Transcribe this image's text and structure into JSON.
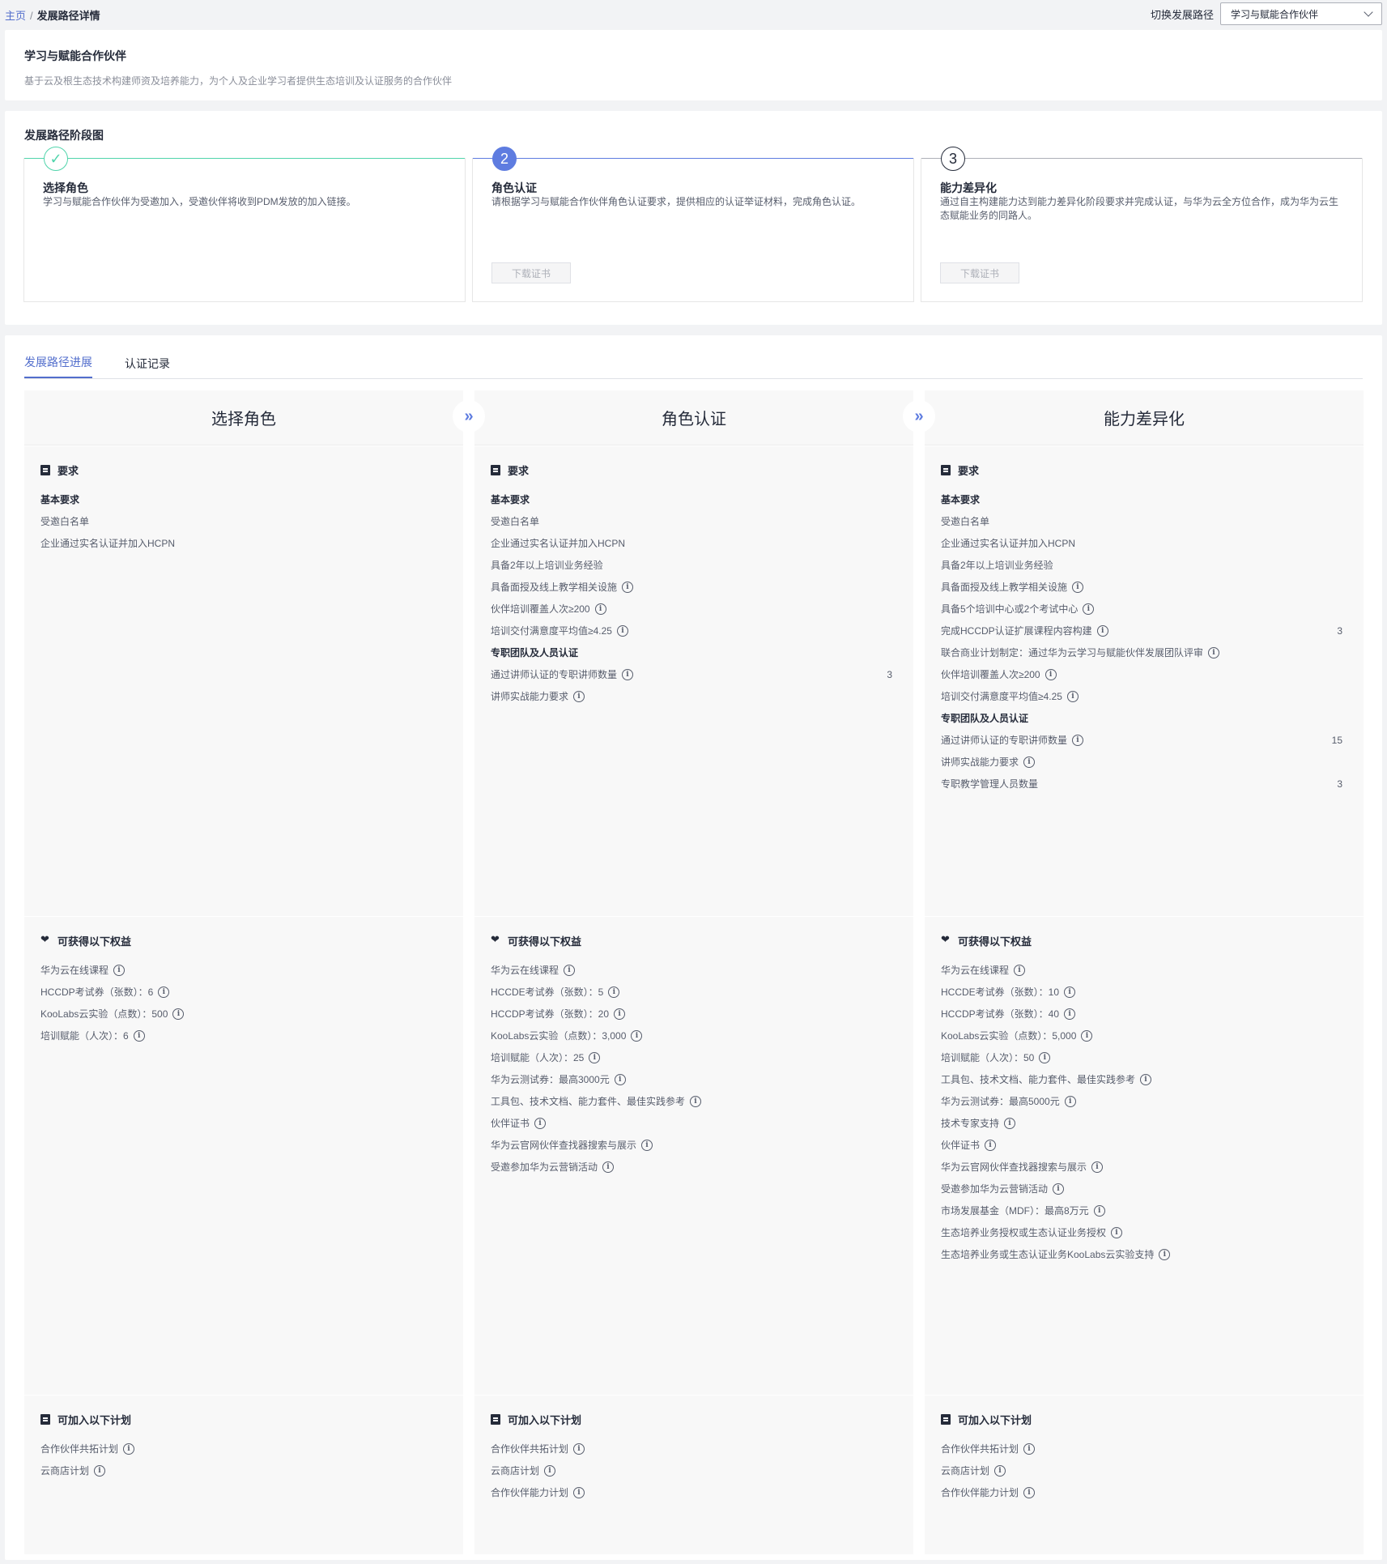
{
  "breadcrumb": {
    "home": "主页",
    "sep": "/",
    "current": "发展路径详情"
  },
  "switcher": {
    "label": "切换发展路径",
    "selected": "学习与赋能合作伙伴"
  },
  "intro": {
    "title": "学习与赋能合作伙伴",
    "desc": "基于云及根生态技术构建师资及培养能力，为个人及企业学习者提供生态培训及认证服务的合作伙伴"
  },
  "stageMap": {
    "title": "发展路径阶段图",
    "stages": [
      {
        "num": "✓",
        "title": "选择角色",
        "desc": "学习与赋能合作伙伴为受邀加入，受邀伙伴将收到PDM发放的加入链接。"
      },
      {
        "num": "2",
        "title": "角色认证",
        "desc": "请根据学习与赋能合作伙伴角色认证要求，提供相应的认证举证材料，完成角色认证。",
        "btn": "下载证书"
      },
      {
        "num": "3",
        "title": "能力差异化",
        "desc": "通过自主构建能力达到能力差异化阶段要求并完成认证，与华为云全方位合作，成为华为云生态赋能业务的同路人。",
        "btn": "下载证书"
      }
    ]
  },
  "tabs": [
    "发展路径进展",
    "认证记录"
  ],
  "sectionTitles": {
    "req": "要求",
    "ben": "可获得以下权益",
    "plan": "可加入以下计划"
  },
  "columns": [
    {
      "title": "选择角色",
      "req": [
        {
          "t": "基本要求",
          "bold": true
        },
        {
          "t": "受邀白名单"
        },
        {
          "t": "企业通过实名认证并加入HCPN"
        }
      ],
      "ben": [
        {
          "t": "华为云在线课程",
          "i": true
        },
        {
          "t": "HCCDP考试券（张数）：6",
          "i": true
        },
        {
          "t": "KooLabs云实验（点数）：500",
          "i": true
        },
        {
          "t": "培训赋能（人次）：6",
          "i": true
        }
      ],
      "plan": [
        {
          "t": "合作伙伴共拓计划",
          "i": true
        },
        {
          "t": "云商店计划",
          "i": true
        }
      ]
    },
    {
      "title": "角色认证",
      "req": [
        {
          "t": "基本要求",
          "bold": true
        },
        {
          "t": "受邀白名单"
        },
        {
          "t": "企业通过实名认证并加入HCPN"
        },
        {
          "t": "具备2年以上培训业务经验"
        },
        {
          "t": "具备面授及线上教学相关设施",
          "i": true
        },
        {
          "t": "伙伴培训覆盖人次≥200",
          "i": true
        },
        {
          "t": "培训交付满意度平均值≥4.25",
          "i": true
        },
        {
          "t": "专职团队及人员认证",
          "bold": true
        },
        {
          "t": "通过讲师认证的专职讲师数量",
          "i": true,
          "n": "3"
        },
        {
          "t": "讲师实战能力要求",
          "i": true
        }
      ],
      "ben": [
        {
          "t": "华为云在线课程",
          "i": true
        },
        {
          "t": "HCCDE考试券（张数）：5",
          "i": true
        },
        {
          "t": "HCCDP考试券（张数）：20",
          "i": true
        },
        {
          "t": "KooLabs云实验（点数）：3,000",
          "i": true
        },
        {
          "t": "培训赋能（人次）：25",
          "i": true
        },
        {
          "t": "华为云测试券：最高3000元",
          "i": true
        },
        {
          "t": "工具包、技术文档、能力套件、最佳实践参考",
          "i": true
        },
        {
          "t": "伙伴证书",
          "i": true
        },
        {
          "t": "华为云官网伙伴查找器搜索与展示",
          "i": true
        },
        {
          "t": "受邀参加华为云营销活动",
          "i": true
        }
      ],
      "plan": [
        {
          "t": "合作伙伴共拓计划",
          "i": true
        },
        {
          "t": "云商店计划",
          "i": true
        },
        {
          "t": "合作伙伴能力计划",
          "i": true
        }
      ]
    },
    {
      "title": "能力差异化",
      "req": [
        {
          "t": "基本要求",
          "bold": true
        },
        {
          "t": "受邀白名单"
        },
        {
          "t": "企业通过实名认证并加入HCPN"
        },
        {
          "t": "具备2年以上培训业务经验"
        },
        {
          "t": "具备面授及线上教学相关设施",
          "i": true
        },
        {
          "t": "具备5个培训中心或2个考试中心",
          "i": true
        },
        {
          "t": "完成HCCDP认证扩展课程内容构建",
          "i": true,
          "n": "3"
        },
        {
          "t": "联合商业计划制定：通过华为云学习与赋能伙伴发展团队评审",
          "i": true
        },
        {
          "t": "伙伴培训覆盖人次≥200",
          "i": true
        },
        {
          "t": "培训交付满意度平均值≥4.25",
          "i": true
        },
        {
          "t": "专职团队及人员认证",
          "bold": true
        },
        {
          "t": "通过讲师认证的专职讲师数量",
          "i": true,
          "n": "15"
        },
        {
          "t": "讲师实战能力要求",
          "i": true
        },
        {
          "t": "专职教学管理人员数量",
          "n": "3"
        }
      ],
      "ben": [
        {
          "t": "华为云在线课程",
          "i": true
        },
        {
          "t": "HCCDE考试券（张数）：10",
          "i": true
        },
        {
          "t": "HCCDP考试券（张数）：40",
          "i": true
        },
        {
          "t": "KooLabs云实验（点数）：5,000",
          "i": true
        },
        {
          "t": "培训赋能（人次）：50",
          "i": true
        },
        {
          "t": "工具包、技术文档、能力套件、最佳实践参考",
          "i": true
        },
        {
          "t": "华为云测试券：最高5000元",
          "i": true
        },
        {
          "t": "技术专家支持",
          "i": true
        },
        {
          "t": "伙伴证书",
          "i": true
        },
        {
          "t": "华为云官网伙伴查找器搜索与展示",
          "i": true
        },
        {
          "t": "受邀参加华为云营销活动",
          "i": true
        },
        {
          "t": "市场发展基金（MDF）：最高8万元",
          "i": true
        },
        {
          "t": "生态培养业务授权或生态认证业务授权",
          "i": true
        },
        {
          "t": "生态培养业务或生态认证业务KooLabs云实验支持",
          "i": true
        }
      ],
      "plan": [
        {
          "t": "合作伙伴共拓计划",
          "i": true
        },
        {
          "t": "云商店计划",
          "i": true
        },
        {
          "t": "合作伙伴能力计划",
          "i": true
        }
      ]
    }
  ],
  "colors": {
    "primary": "#5e7ce0",
    "success": "#50d4ab",
    "text": "#252b3a"
  }
}
